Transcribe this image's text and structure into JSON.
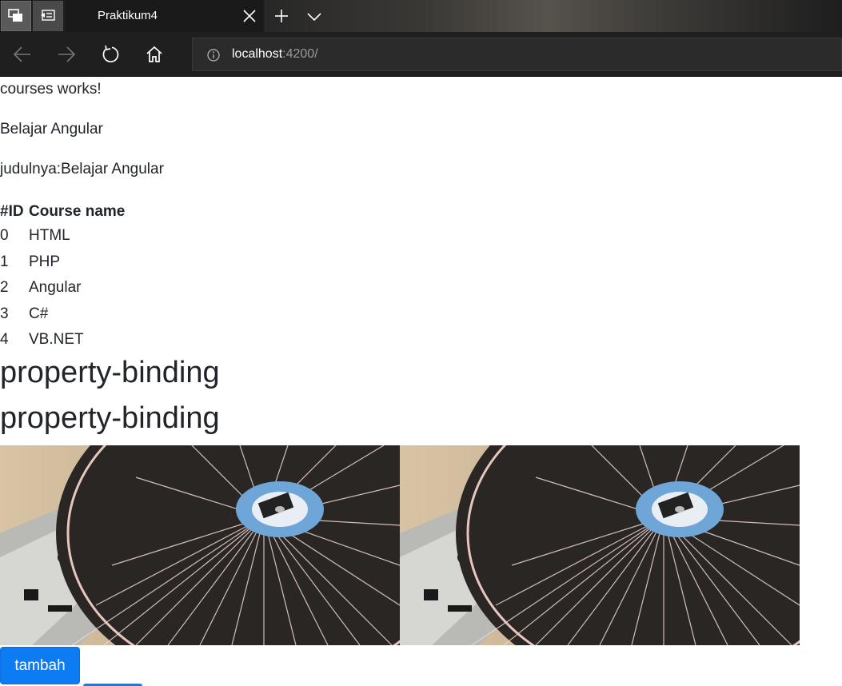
{
  "browser": {
    "tab_title": "Praktikum4",
    "url_host": "localhost",
    "url_rest": ":4200/"
  },
  "content": {
    "line1": "courses works!",
    "line2": "Belajar Angular",
    "line3": "judulnya:Belajar Angular",
    "table": {
      "headers": [
        "#ID",
        "Course name"
      ],
      "rows": [
        {
          "id": "0",
          "name": "HTML"
        },
        {
          "id": "1",
          "name": "PHP"
        },
        {
          "id": "2",
          "name": "Angular"
        },
        {
          "id": "3",
          "name": "C#"
        },
        {
          "id": "4",
          "name": "VB.NET"
        }
      ]
    },
    "heading1": "property-binding",
    "heading2": "property-binding",
    "button_label": "tambah"
  },
  "colors": {
    "button": "#0d7bf2",
    "tabbar": "#1c1c1c",
    "navbar": "#1f1f1f"
  }
}
